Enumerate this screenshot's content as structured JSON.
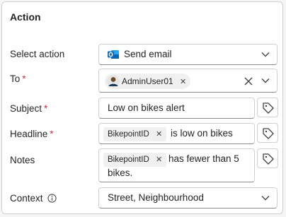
{
  "panel": {
    "title": "Action"
  },
  "select_action": {
    "label": "Select action",
    "value": "Send email",
    "icon": "outlook-icon"
  },
  "to": {
    "label": "To",
    "required_mark": "*",
    "recipient": "AdminUser01"
  },
  "subject": {
    "label": "Subject",
    "required_mark": "*",
    "value": "Low on bikes alert"
  },
  "headline": {
    "label": "Headline",
    "required_mark": "*",
    "token": "BikepointID",
    "text": "is low on bikes"
  },
  "notes": {
    "label": "Notes",
    "token": "BikepointID",
    "text_line1": "has fewer than 5",
    "text_line2": "bikes."
  },
  "context": {
    "label": "Context",
    "value": "Street, Neighbourhood"
  },
  "colors": {
    "required": "#c4314b",
    "outlook_blue": "#0f6cbd",
    "border": "#d1d1d1"
  }
}
